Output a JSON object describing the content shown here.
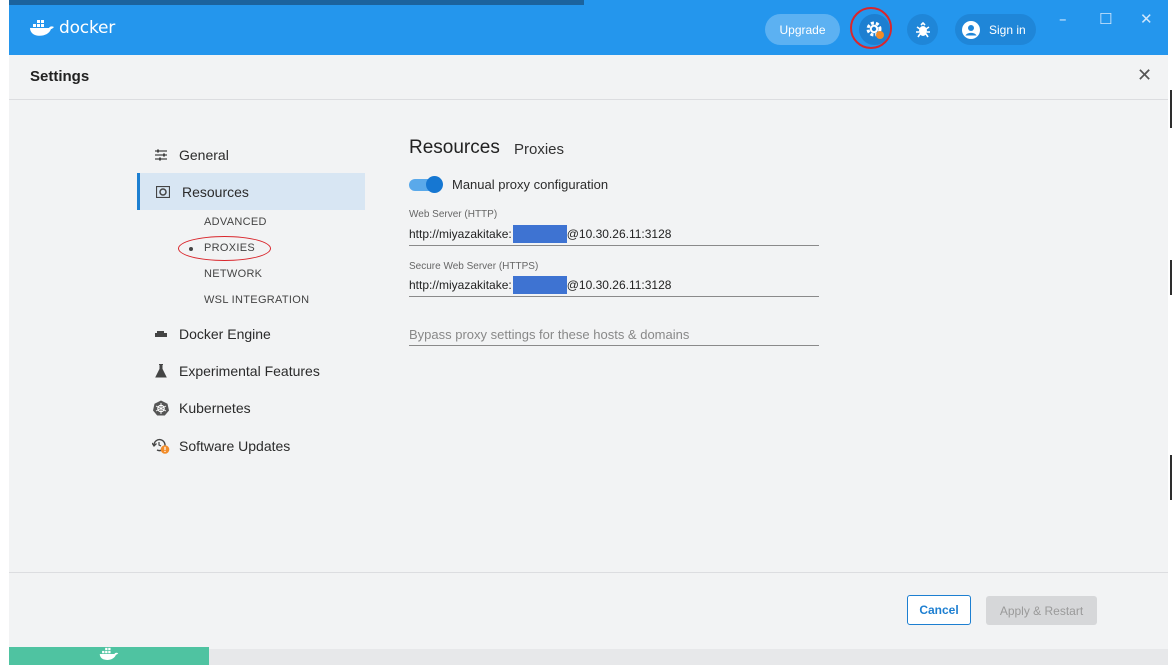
{
  "titlebar": {
    "logo_text": "docker",
    "upgrade_label": "Upgrade",
    "signin_label": "Sign in",
    "icons": [
      "docker-whale-icon",
      "gear-icon",
      "bug-icon",
      "user-icon"
    ],
    "window_controls": [
      "–",
      "☐",
      "✕"
    ]
  },
  "header": {
    "title": "Settings",
    "close": "✕"
  },
  "nav": {
    "items": [
      {
        "label": "General",
        "icon": "sliders-icon"
      },
      {
        "label": "Resources",
        "icon": "resources-icon"
      },
      {
        "label": "Docker Engine",
        "icon": "engine-icon"
      },
      {
        "label": "Experimental Features",
        "icon": "flask-icon"
      },
      {
        "label": "Kubernetes",
        "icon": "kubernetes-icon"
      },
      {
        "label": "Software Updates",
        "icon": "update-icon"
      }
    ],
    "sub_items": [
      "ADVANCED",
      "PROXIES",
      "NETWORK",
      "WSL INTEGRATION"
    ]
  },
  "content": {
    "title": "Resources",
    "subtitle": "Proxies",
    "toggle_label": "Manual proxy configuration",
    "http_label": "Web Server (HTTP)",
    "http_prefix": "http://miyazakitake:",
    "http_suffix": "@10.30.26.11:3128",
    "https_label": "Secure Web Server (HTTPS)",
    "https_prefix": "http://miyazakitake:",
    "https_suffix": "@10.30.26.11:3128",
    "bypass_placeholder": "Bypass proxy settings for these hosts & domains"
  },
  "footer": {
    "cancel_label": "Cancel",
    "apply_label": "Apply & Restart"
  },
  "colors": {
    "brand": "#2496ed",
    "accent": "#1d7fd1",
    "highlight": "#d9262c"
  }
}
